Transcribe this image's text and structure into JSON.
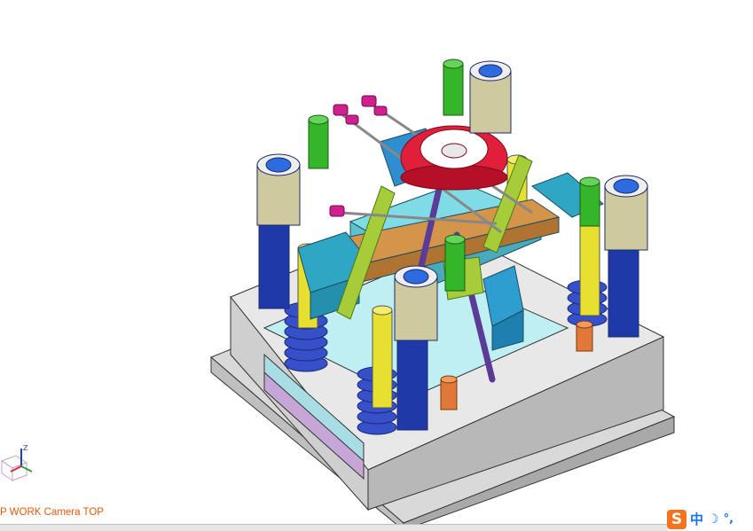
{
  "viewport": {
    "camera_label": "P WORK Camera TOP",
    "triad_axis_label": "Z",
    "background": "#ffffff"
  },
  "ime_toolbar": {
    "logo": "S",
    "language": "中",
    "moon_icon": "moon-icon",
    "punctuation": "°,"
  },
  "colors": {
    "plate": "#e9e9e9",
    "spring": "#3550c8",
    "pillar_dark": "#1f3aa8",
    "pillar_yellow": "#e8e030",
    "bush": "#d8d0a0",
    "ring": "#e0203a",
    "block_cyan": "#30a8c8",
    "slider_brown": "#c8843c",
    "green_pin": "#34b52a",
    "magenta_pin": "#d02090",
    "purple_rod": "#9a70d8",
    "camera_label": "#e05a0a"
  }
}
